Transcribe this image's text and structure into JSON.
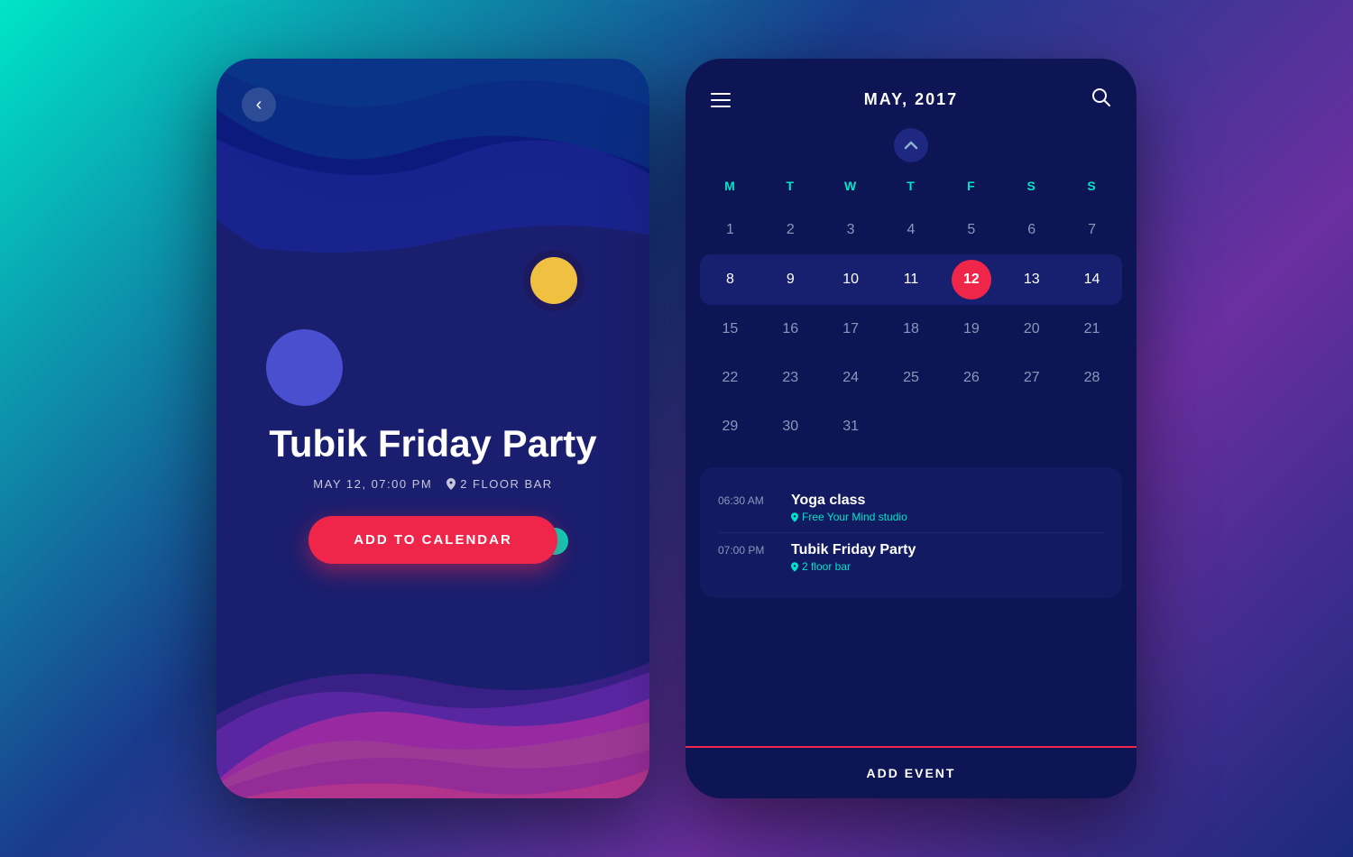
{
  "left_phone": {
    "back_label": "‹",
    "event_title": "Tubik Friday Party",
    "event_date": "MAY 12, 07:00 PM",
    "event_location": "2 FLOOR BAR",
    "add_button_label": "ADD TO CALENDAR"
  },
  "right_phone": {
    "month_title": "MAY, 2017",
    "up_chevron": "^",
    "day_headers": [
      "M",
      "T",
      "W",
      "T",
      "F",
      "S",
      "S"
    ],
    "weeks": [
      [
        "",
        "",
        "",
        "",
        "",
        "1",
        "2",
        "3",
        "4",
        "5",
        "6",
        "7"
      ],
      [
        "8",
        "9",
        "10",
        "11",
        "12",
        "13",
        "14"
      ],
      [
        "15",
        "16",
        "17",
        "18",
        "19",
        "20",
        "21"
      ],
      [
        "22",
        "23",
        "24",
        "25",
        "26",
        "27",
        "28"
      ],
      [
        "29",
        "30",
        "31",
        "",
        "",
        "",
        ""
      ]
    ],
    "week1": [
      {
        "day": "1"
      },
      {
        "day": "2"
      },
      {
        "day": "3"
      },
      {
        "day": "4"
      },
      {
        "day": "5"
      },
      {
        "day": "6"
      },
      {
        "day": "7"
      }
    ],
    "week2": [
      {
        "day": "8"
      },
      {
        "day": "9"
      },
      {
        "day": "10"
      },
      {
        "day": "11"
      },
      {
        "day": "12",
        "today": true
      },
      {
        "day": "13"
      },
      {
        "day": "14"
      }
    ],
    "week3": [
      {
        "day": "15"
      },
      {
        "day": "16"
      },
      {
        "day": "17"
      },
      {
        "day": "18"
      },
      {
        "day": "19"
      },
      {
        "day": "20"
      },
      {
        "day": "21"
      }
    ],
    "week4": [
      {
        "day": "22"
      },
      {
        "day": "23"
      },
      {
        "day": "24"
      },
      {
        "day": "25"
      },
      {
        "day": "26"
      },
      {
        "day": "27"
      },
      {
        "day": "28"
      }
    ],
    "week5": [
      {
        "day": "29"
      },
      {
        "day": "30"
      },
      {
        "day": "31"
      },
      {
        "day": ""
      },
      {
        "day": ""
      },
      {
        "day": ""
      },
      {
        "day": ""
      }
    ],
    "events": [
      {
        "time": "06:30 AM",
        "name": "Yoga class",
        "location": "Free Your Mind studio"
      },
      {
        "time": "07:00 PM",
        "name": "Tubik Friday Party",
        "location": "2 floor bar"
      }
    ],
    "add_event_label": "ADD EVENT"
  },
  "colors": {
    "today_bg": "#f0254a",
    "accent": "#00e5c8",
    "primary": "#0d1554"
  }
}
